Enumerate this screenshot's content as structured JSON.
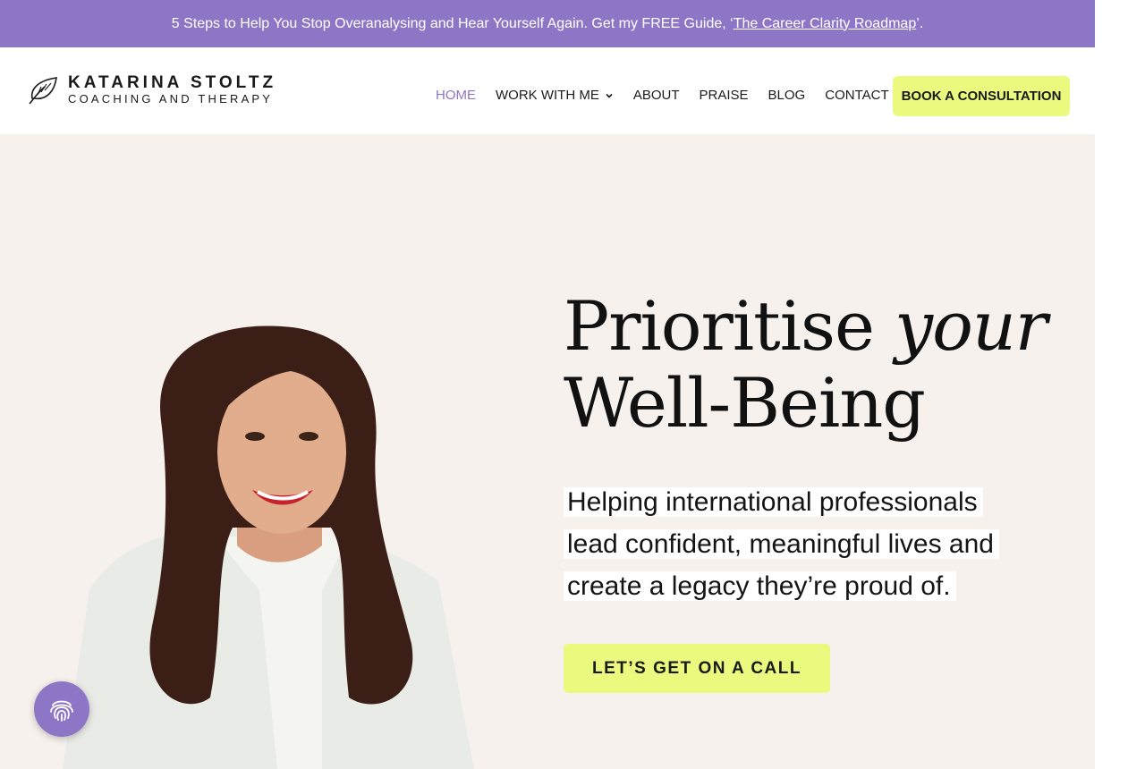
{
  "announcement": {
    "text": "5 Steps to Help You Stop Overanalysing and Hear Yourself Again. Get my FREE Guide, ‘",
    "link": "The Career Clarity Roadmap",
    "suffix": "’."
  },
  "brand": {
    "name": "KATARINA STOLTZ",
    "tagline": "COACHING AND THERAPY",
    "icon": "leaf-icon"
  },
  "nav": {
    "items": [
      {
        "label": "HOME",
        "active": true
      },
      {
        "label": "WORK WITH ME",
        "has_dropdown": true
      },
      {
        "label": "ABOUT"
      },
      {
        "label": "PRAISE"
      },
      {
        "label": "BLOG"
      },
      {
        "label": "CONTACT"
      }
    ],
    "cta": "BOOK A CONSULTATION"
  },
  "hero": {
    "headline_line1": "Prioritise ",
    "headline_em": "your",
    "headline_line2": "Well-Being",
    "subtext_line1": "Helping international professionals",
    "subtext_line2": "lead confident, meaningful lives and",
    "subtext_line3": "create a legacy they’re proud of.",
    "cta": "LET’S GET ON A CALL"
  },
  "widgets": {
    "accessibility_icon": "fingerprint-icon"
  },
  "colors": {
    "accent_purple": "#8d76c5",
    "cta_yellow": "#ebf97e",
    "hero_bg": "#f7f1ee"
  }
}
